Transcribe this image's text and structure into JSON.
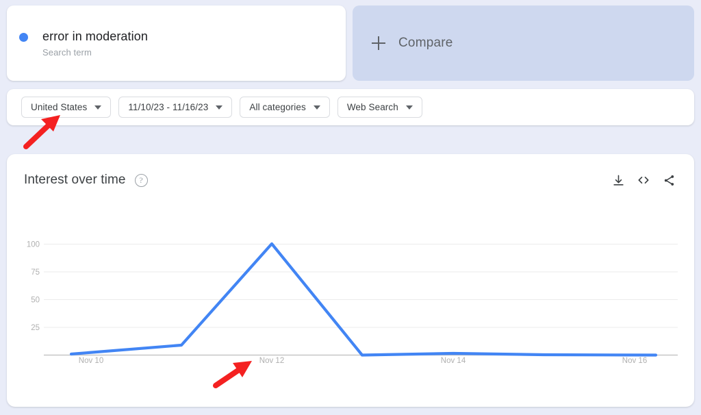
{
  "search_term_card": {
    "term": "error in moderation",
    "subtitle": "Search term",
    "dot_color": "#4285f4"
  },
  "compare_card": {
    "label": "Compare",
    "icon": "plus-icon",
    "background": "#ced8ef"
  },
  "filters": [
    {
      "label": "United States",
      "name": "location-filter"
    },
    {
      "label": "11/10/23 - 11/16/23",
      "name": "date-range-filter"
    },
    {
      "label": "All categories",
      "name": "category-filter"
    },
    {
      "label": "Web Search",
      "name": "search-type-filter"
    }
  ],
  "chart_card": {
    "title": "Interest over time",
    "help_icon": "help-circle-icon",
    "tools": [
      {
        "name": "download-icon",
        "label": "Download"
      },
      {
        "name": "embed-code-icon",
        "label": "Embed"
      },
      {
        "name": "share-icon",
        "label": "Share"
      }
    ]
  },
  "annotations": [
    {
      "name": "red-arrow-location-filter",
      "color": "#f42121",
      "points_to": "United States"
    },
    {
      "name": "red-arrow-nov-12-tick",
      "color": "#f42121",
      "points_to": "Nov 12"
    }
  ],
  "chart_data": {
    "type": "line",
    "title": "Interest over time",
    "xlabel": "",
    "ylabel": "",
    "ylim": [
      0,
      100
    ],
    "yticks": [
      25,
      50,
      75,
      100
    ],
    "grid": true,
    "legend_position": "none",
    "line_color": "#4285f4",
    "x": [
      "Nov 10",
      "Nov 11",
      "Nov 12",
      "Nov 13",
      "Nov 14",
      "Nov 15",
      "Nov 16"
    ],
    "tick_labels": [
      "Nov 10",
      "Nov 12",
      "Nov 14",
      "Nov 16"
    ],
    "series": [
      {
        "name": "error in moderation",
        "values": [
          1,
          9,
          100,
          0,
          1,
          0,
          0
        ]
      }
    ]
  }
}
